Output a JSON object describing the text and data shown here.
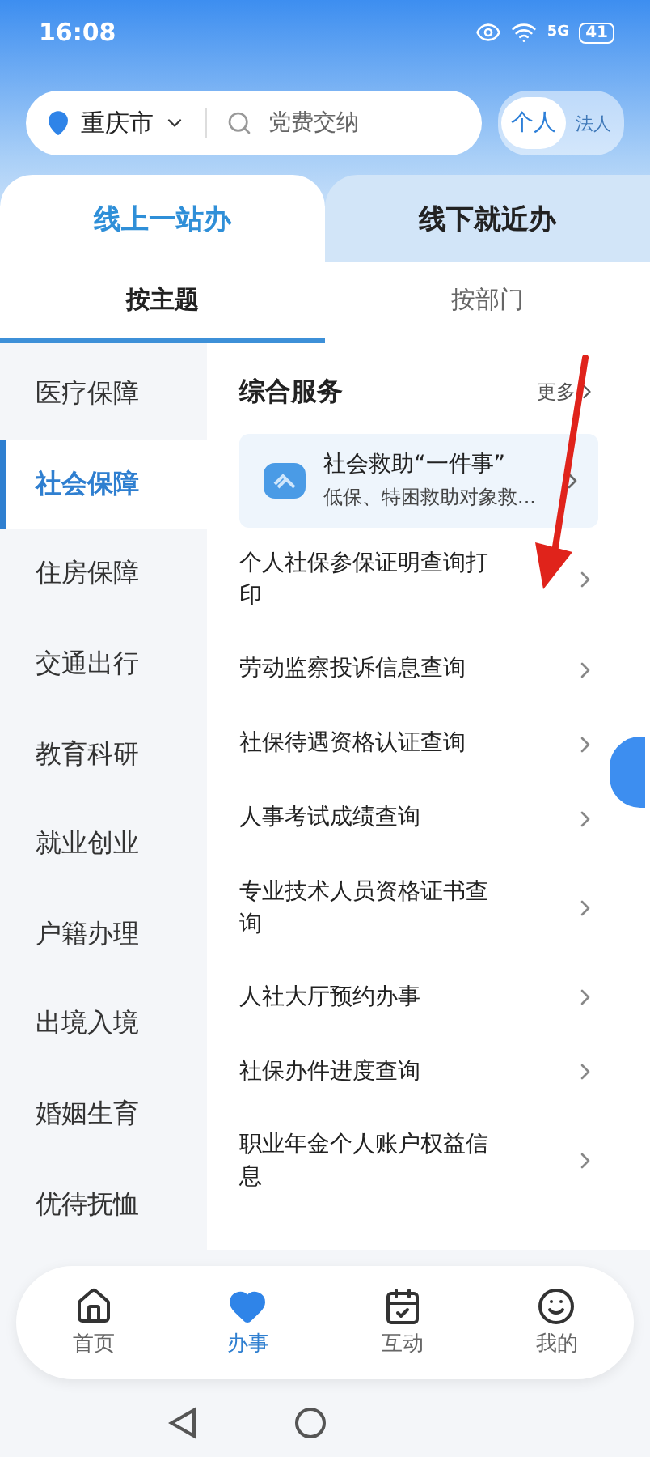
{
  "status_bar": {
    "time": "16:08",
    "battery": "41",
    "network": "5G"
  },
  "search_bar": {
    "city": "重庆市",
    "placeholder": "党费交纳"
  },
  "user_type_toggle": [
    {
      "label": "个人",
      "selected": true
    },
    {
      "label": "法人",
      "selected": false
    }
  ],
  "tabs": [
    {
      "label": "线上一站办",
      "selected": true
    },
    {
      "label": "线下就近办",
      "selected": false
    }
  ],
  "sub_tabs": [
    {
      "label": "按主题",
      "selected": true
    },
    {
      "label": "按部门",
      "selected": false
    }
  ],
  "sidebar": {
    "items": [
      {
        "label": "医疗保障",
        "selected": false
      },
      {
        "label": "社会保障",
        "selected": true
      },
      {
        "label": "住房保障",
        "selected": false
      },
      {
        "label": "交通出行",
        "selected": false
      },
      {
        "label": "教育科研",
        "selected": false
      },
      {
        "label": "就业创业",
        "selected": false
      },
      {
        "label": "户籍办理",
        "selected": false
      },
      {
        "label": "出境入境",
        "selected": false
      },
      {
        "label": "婚姻生育",
        "selected": false
      },
      {
        "label": "优待抚恤",
        "selected": false
      }
    ]
  },
  "section": {
    "title": "综合服务",
    "more": "更多",
    "featured": {
      "title": "社会救助“一件事”",
      "subtitle": "低保、特困救助对象救..."
    },
    "items": [
      {
        "label": "个人社保参保证明查询打印"
      },
      {
        "label": "劳动监察投诉信息查询"
      },
      {
        "label": "社保待遇资格认证查询"
      },
      {
        "label": "人事考试成绩查询"
      },
      {
        "label": "专业技术人员资格证书查询"
      },
      {
        "label": "人社大厅预约办事"
      },
      {
        "label": "社保办件进度查询"
      },
      {
        "label": "职业年金个人账户权益信息"
      }
    ]
  },
  "bottom_nav": [
    {
      "label": "首页",
      "kind": "home",
      "selected": false
    },
    {
      "label": "办事",
      "kind": "heart",
      "selected": true
    },
    {
      "label": "互动",
      "kind": "calendar",
      "selected": false
    },
    {
      "label": "我的",
      "kind": "smile",
      "selected": false
    }
  ]
}
